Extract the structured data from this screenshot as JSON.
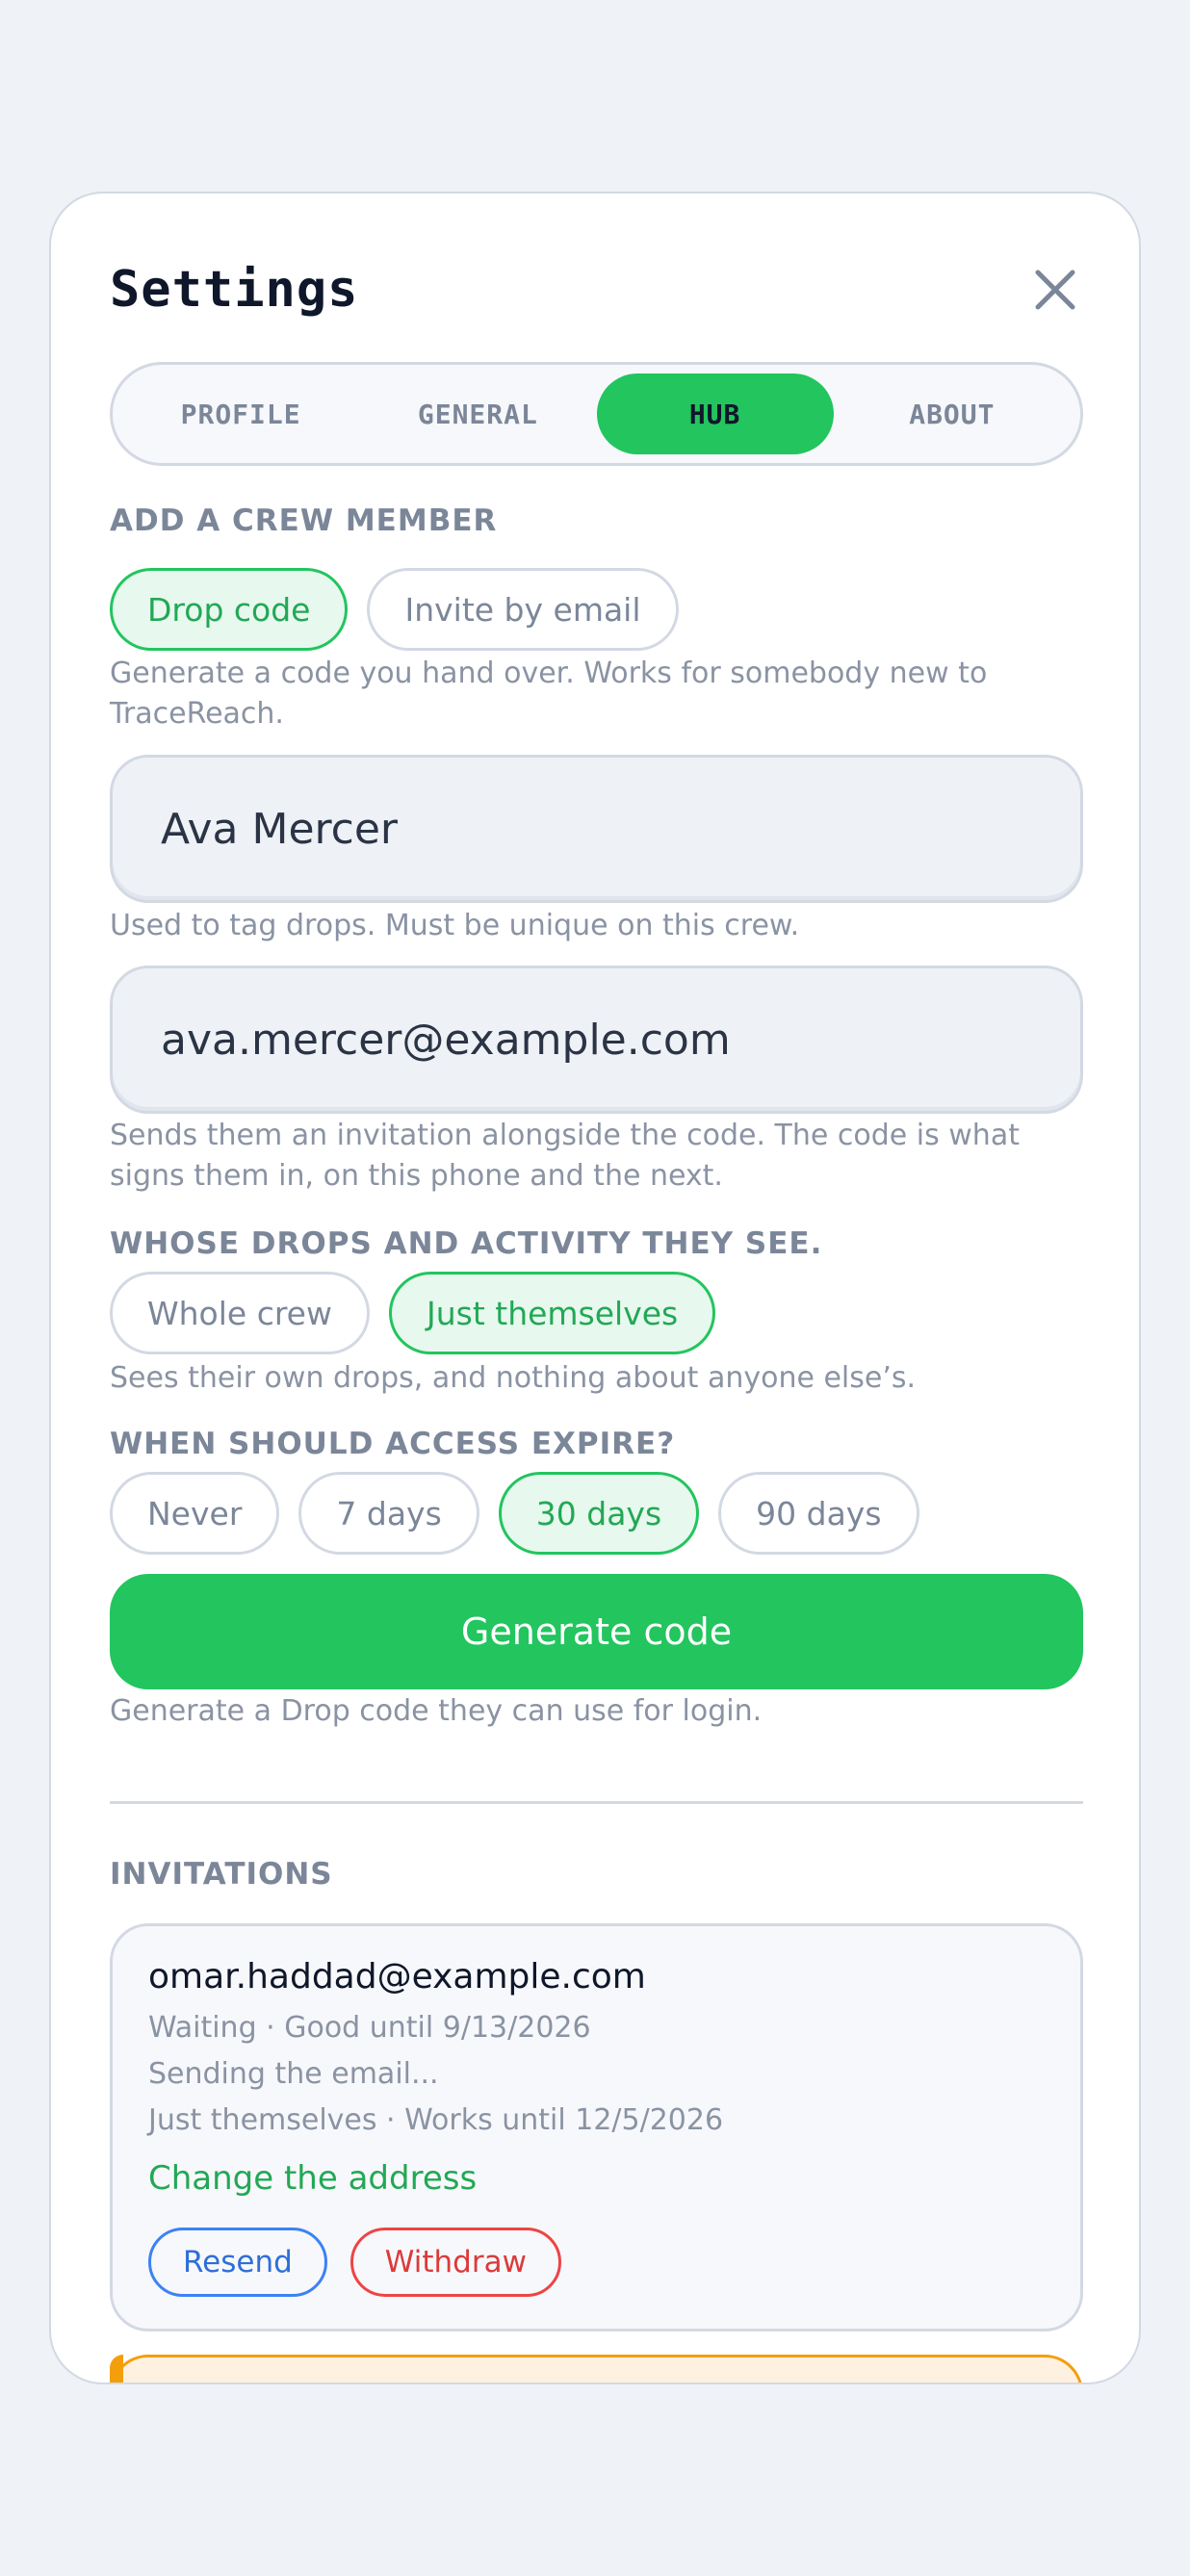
{
  "window": {
    "title": "Settings"
  },
  "tabs": [
    {
      "label": "PROFILE",
      "active": false
    },
    {
      "label": "GENERAL",
      "active": false
    },
    {
      "label": "HUB",
      "active": true
    },
    {
      "label": "ABOUT",
      "active": false
    }
  ],
  "add_member": {
    "heading": "ADD A CREW MEMBER",
    "method_options": [
      "Drop code",
      "Invite by email"
    ],
    "method_selected": "Drop code",
    "method_help": "Generate a code you hand over. Works for somebody new to TraceReach.",
    "name_value": "Ava Mercer",
    "name_help": "Used to tag drops. Must be unique on this crew.",
    "email_value": "ava.mercer@example.com",
    "email_help": "Sends them an invitation alongside the code. The code is what signs them in, on this phone and the next."
  },
  "visibility": {
    "heading": "WHOSE DROPS AND ACTIVITY THEY SEE.",
    "options": [
      "Whole crew",
      "Just themselves"
    ],
    "selected": "Just themselves",
    "help": "Sees their own drops, and nothing about anyone else’s."
  },
  "expiry": {
    "heading": "WHEN SHOULD ACCESS EXPIRE?",
    "options": [
      "Never",
      "7 days",
      "30 days",
      "90 days"
    ],
    "selected": "30 days"
  },
  "generate": {
    "label": "Generate code",
    "help": "Generate a Drop code they can use for login."
  },
  "invitations": {
    "heading": "INVITATIONS",
    "items": [
      {
        "email": "omar.haddad@example.com",
        "status": "Waiting · Good until 9/13/2026",
        "progress": "Sending the email...",
        "scope": "Just themselves · Works until 12/5/2026",
        "change_link": "Change the address",
        "resend_label": "Resend",
        "withdraw_label": "Withdraw"
      }
    ]
  },
  "colors": {
    "accent": "#22c55e",
    "danger": "#ef4444",
    "info": "#3b82f6",
    "warning": "#f59e0b"
  }
}
